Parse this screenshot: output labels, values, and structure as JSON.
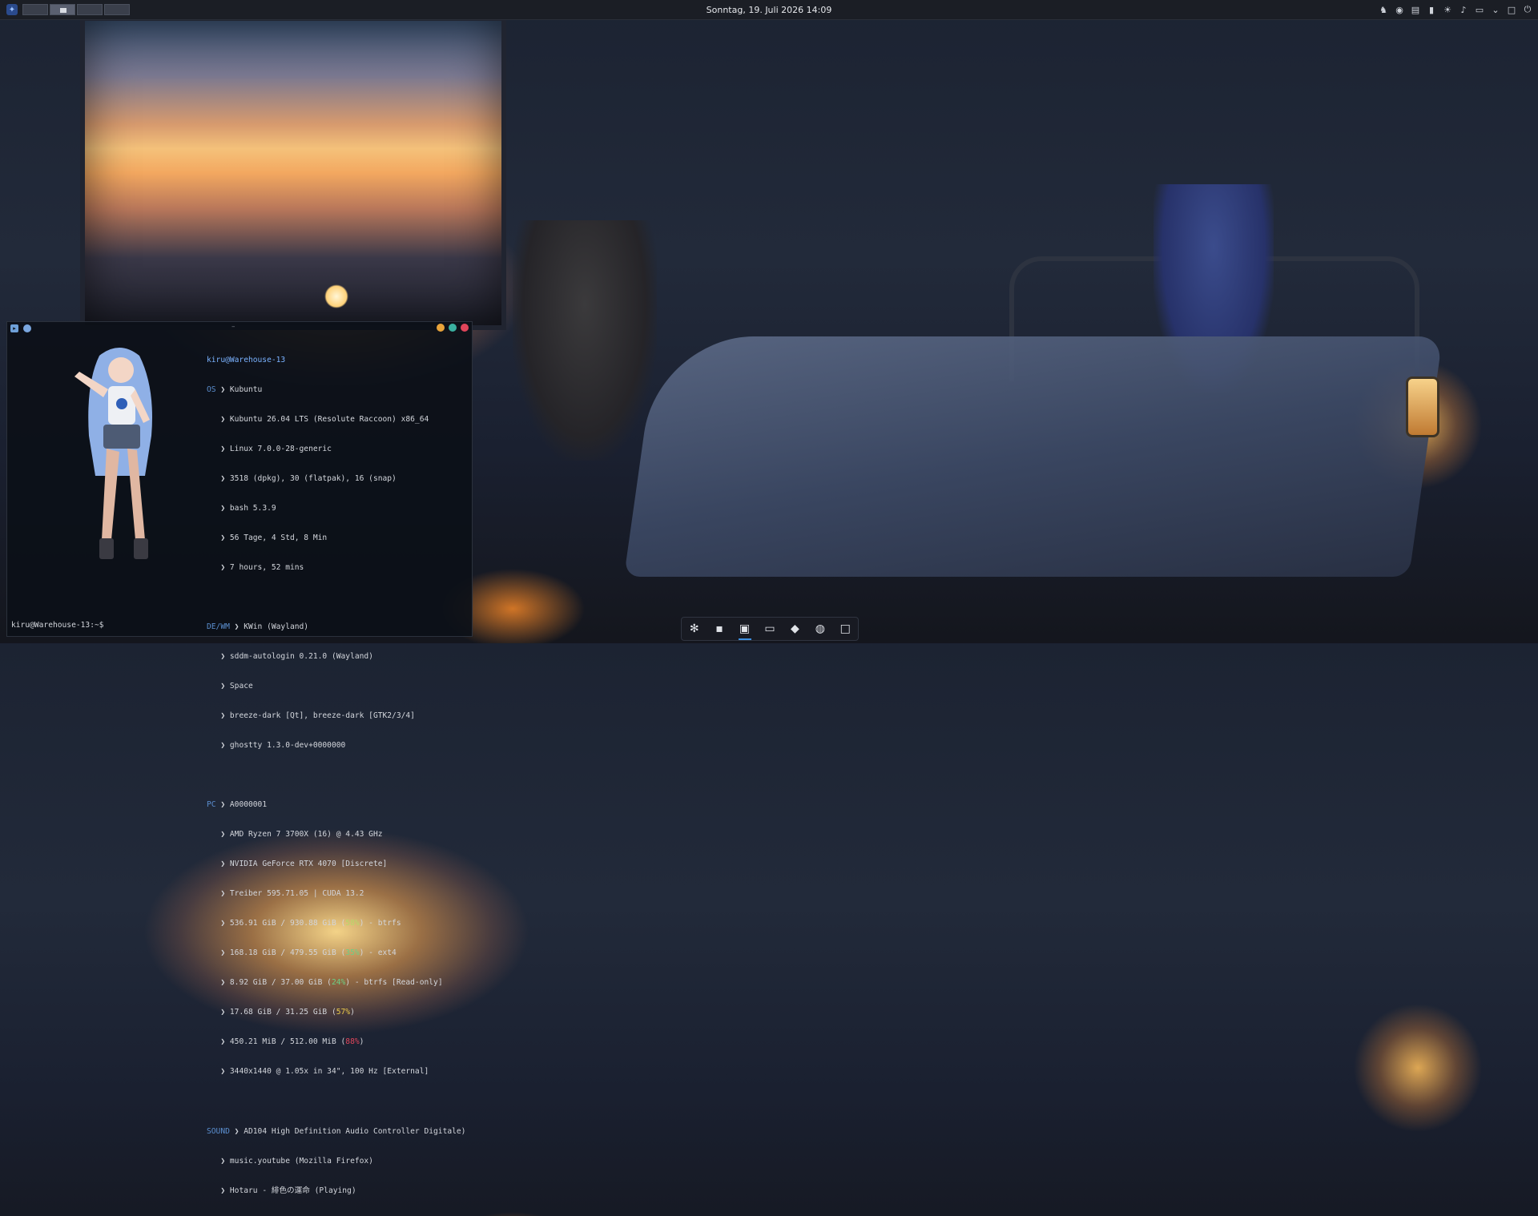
{
  "panel": {
    "clock": "Sonntag, 19. Juli 2026 14:09",
    "tray_icons": [
      "chess-icon",
      "media-icon",
      "clipboard-icon",
      "battery-icon",
      "brightness-icon",
      "volume-icon",
      "display-icon",
      "chevron-down-icon",
      "desktop-icon",
      "power-icon"
    ]
  },
  "terminal": {
    "title_dash": "–",
    "user_host": "kiru@Warehouse-13",
    "lines": [
      {
        "key": "OS",
        "val": "Kubuntu"
      },
      {
        "key": "",
        "val": "Kubuntu 26.04 LTS (Resolute Raccoon) x86_64"
      },
      {
        "key": "",
        "val": "Linux 7.0.0-28-generic"
      },
      {
        "key": "",
        "val": "3518 (dpkg), 30 (flatpak), 16 (snap)"
      },
      {
        "key": "",
        "val": "bash 5.3.9"
      },
      {
        "key": "",
        "val": "56 Tage, 4 Std, 8 Min"
      },
      {
        "key": "",
        "val": "7 hours, 52 mins"
      },
      {
        "key": "",
        "val": ""
      },
      {
        "key": "DE/WM",
        "val": "KWin (Wayland)"
      },
      {
        "key": "",
        "val": "sddm-autologin 0.21.0 (Wayland)"
      },
      {
        "key": "",
        "val": "Space"
      },
      {
        "key": "",
        "val": "breeze-dark [Qt], breeze-dark [GTK2/3/4]"
      },
      {
        "key": "",
        "val": "ghostty 1.3.0-dev+0000000"
      },
      {
        "key": "",
        "val": ""
      },
      {
        "key": "PC",
        "val": "A0000001"
      },
      {
        "key": "",
        "val": "AMD Ryzen 7 3700X (16) @ 4.43 GHz"
      },
      {
        "key": "",
        "val": "NVIDIA GeForce RTX 4070 [Discrete]"
      },
      {
        "key": "",
        "val": "Treiber 595.71.05 | CUDA 13.2"
      }
    ],
    "disks": [
      {
        "pre": "536.91 GiB / 930.88 GiB (",
        "pct": "58%",
        "post": ") - btrfs",
        "level": "ok"
      },
      {
        "pre": "168.18 GiB / 479.55 GiB (",
        "pct": "35%",
        "post": ") - ext4",
        "level": "mid"
      },
      {
        "pre": "8.92 GiB / 37.00 GiB (",
        "pct": "24%",
        "post": ") - btrfs [Read-only]",
        "level": "mid"
      },
      {
        "pre": "17.68 GiB / 31.25 GiB (",
        "pct": "57%",
        "post": ")",
        "level": "warn"
      },
      {
        "pre": "450.21 MiB / 512.00 MiB (",
        "pct": "88%",
        "post": ")",
        "level": "bad"
      }
    ],
    "display": "3440x1440 @ 1.05x in 34\", 100 Hz [External]",
    "sound_key": "SOUND",
    "sound": "AD104 High Definition Audio Controller Digitale)",
    "media_source": "music.youtube (Mozilla Firefox)",
    "media_track": "Hotaru - 緋色の運命 (Playing)",
    "prompt": "kiru@Warehouse-13:~$"
  },
  "dock": {
    "apps": [
      "settings-icon",
      "terminal-icon",
      "konsole-icon",
      "files-icon",
      "discover-icon",
      "firefox-icon",
      "window-icon"
    ]
  }
}
